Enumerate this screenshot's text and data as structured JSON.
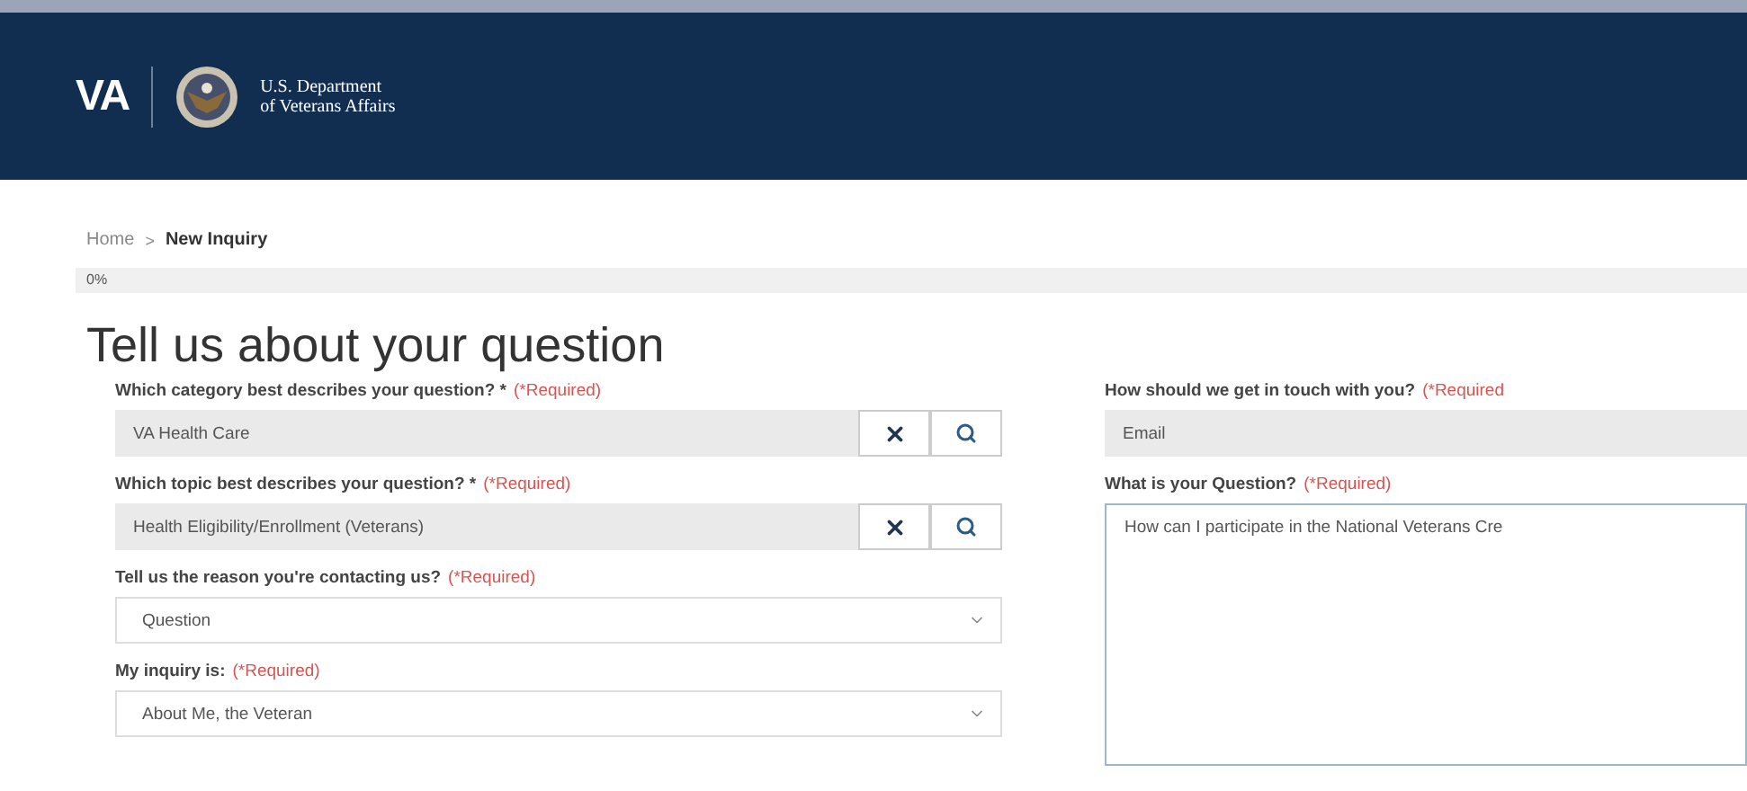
{
  "header": {
    "logo": "VA",
    "department_line_1": "U.S. Department",
    "department_line_2": "of Veterans Affairs"
  },
  "breadcrumb": [
    {
      "label": "Home",
      "current": false
    },
    {
      "label": "New Inquiry",
      "current": true
    }
  ],
  "breadcrumb_separator": ">",
  "progress": {
    "label": "0%",
    "level": 0
  },
  "heading": "Tell us about your question",
  "left_fields": [
    {
      "kind": "lookup",
      "label": "Which category best describes your question? *",
      "required": "(*Required)",
      "value": "VA Health Care"
    },
    {
      "kind": "lookup",
      "label": "Which topic best describes your question? *",
      "required": "(*Required)",
      "value": "Health Eligibility/Enrollment (Veterans)"
    },
    {
      "kind": "select",
      "label": "Tell us the reason you're contacting us?",
      "required": "(*Required)",
      "value": "Question"
    },
    {
      "kind": "select",
      "label": "My inquiry is:",
      "required": "(*Required)",
      "value": "About Me, the Veteran"
    }
  ],
  "right_fields": [
    {
      "kind": "readonly",
      "label": "How should we get in touch with you?",
      "required": "(*Required",
      "value": "Email"
    },
    {
      "kind": "textarea",
      "label": "What is your Question?",
      "required": "(*Required)",
      "value": "How can I participate in the National Veterans Cre"
    }
  ]
}
